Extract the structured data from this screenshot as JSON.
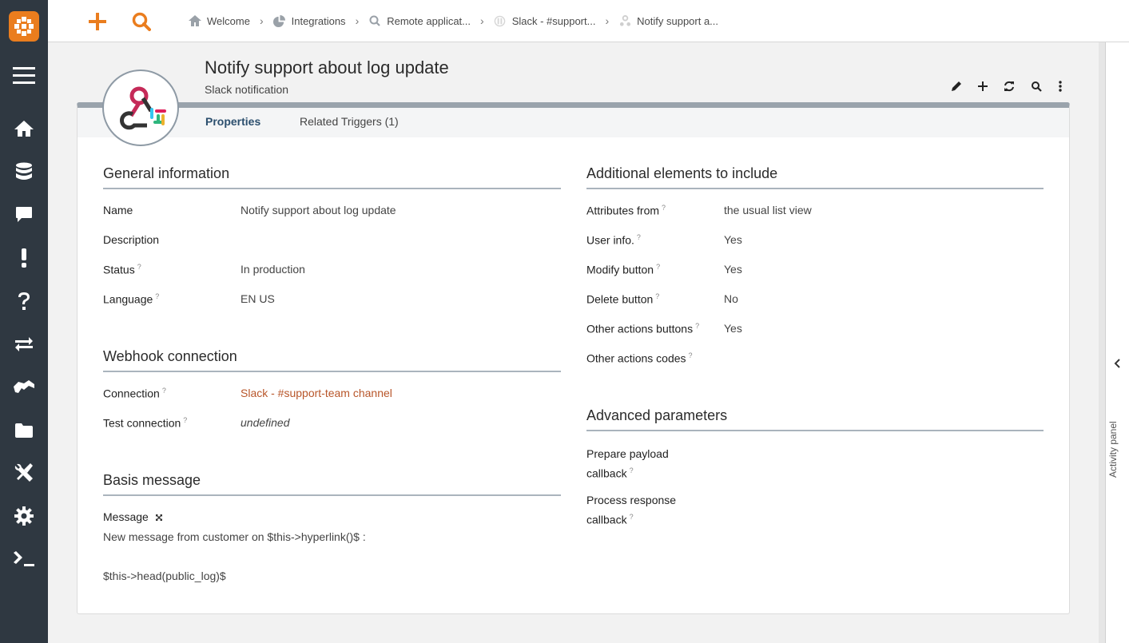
{
  "nav": {
    "items": [
      "home-icon",
      "database-icon",
      "chat-icon",
      "exclamation-icon",
      "question-icon",
      "exchange-icon",
      "handshake-icon",
      "folder-icon",
      "tools-icon",
      "gear-icon",
      "terminal-icon"
    ]
  },
  "topbar": {
    "breadcrumbs": [
      {
        "label": "Welcome",
        "icon": "home-icon"
      },
      {
        "label": "Integrations",
        "icon": "pie-chart-icon"
      },
      {
        "label": "Remote applicat...",
        "icon": "search-icon"
      },
      {
        "label": "Slack - #support...",
        "icon": "slack-icon"
      },
      {
        "label": "Notify support a...",
        "icon": "webhook-icon"
      }
    ]
  },
  "header": {
    "title": "Notify support about log update",
    "subtitle": "Slack notification"
  },
  "tabs": [
    {
      "label": "Properties",
      "active": true
    },
    {
      "label": "Related Triggers (1)",
      "active": false
    }
  ],
  "general": {
    "title": "General information",
    "fields": [
      {
        "label": "Name",
        "value": "Notify support about log update",
        "help": ""
      },
      {
        "label": "Description",
        "value": "",
        "help": ""
      },
      {
        "label": "Status",
        "value": "In production",
        "help": "?"
      },
      {
        "label": "Language",
        "value": "EN US",
        "help": "?"
      }
    ]
  },
  "webhook": {
    "title": "Webhook connection",
    "connection_label": "Connection",
    "connection_value": "Slack - #support-team channel",
    "test_label": "Test connection",
    "test_value": "undefined",
    "help": "?"
  },
  "basis": {
    "title": "Basis message",
    "message_label": "Message",
    "line1": "New message from customer on $this->hyperlink()$ :",
    "line2": "$this->head(public_log)$"
  },
  "additional": {
    "title": "Additional elements to include",
    "fields": [
      {
        "label": "Attributes from",
        "value": "the usual list view"
      },
      {
        "label": "User info.",
        "value": "Yes"
      },
      {
        "label": "Modify button",
        "value": "Yes"
      },
      {
        "label": "Delete button",
        "value": "No"
      },
      {
        "label": "Other actions buttons",
        "value": "Yes"
      },
      {
        "label": "Other actions codes",
        "value": ""
      }
    ],
    "help": "?"
  },
  "advanced": {
    "title": "Advanced parameters",
    "prepare_l1": "Prepare payload",
    "prepare_l2": "callback",
    "process_l1": "Process response",
    "process_l2": "callback",
    "help": "?"
  },
  "activity_panel": {
    "label": "Activity panel"
  },
  "colors": {
    "accent": "#ea7d1e",
    "nav_bg": "#2f3841",
    "link": "#b8562a"
  }
}
